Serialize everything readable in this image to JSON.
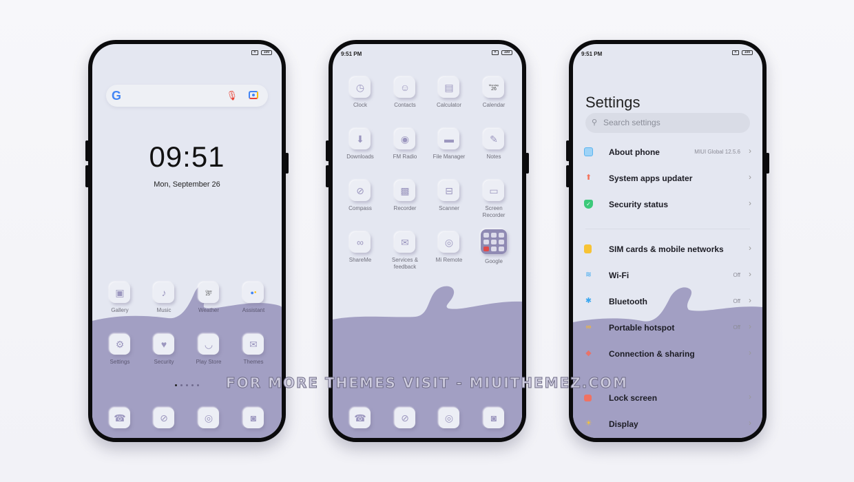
{
  "colors": {
    "screen_bg": "#e4e7f1",
    "wave": "#a29fc3",
    "icon_tint": "#9c97bf",
    "bezel": "#0b0b0d"
  },
  "status": {
    "time": "9:51 PM",
    "sim_icon": "sim-x-icon",
    "battery": "100"
  },
  "home": {
    "search": {
      "logo": "G",
      "mic_icon": "mic-icon",
      "lens_icon": "lens-icon"
    },
    "clock": "09:51",
    "date": "Mon, September 26",
    "weather_widget": {
      "condition": "Clear",
      "temp": "25°"
    },
    "row1": [
      {
        "label": "Gallery",
        "icon": "▣"
      },
      {
        "label": "Music",
        "icon": "♪"
      },
      {
        "label": "Weather",
        "icon": ""
      },
      {
        "label": "Assistant",
        "icon": "●"
      }
    ],
    "row2": [
      {
        "label": "Settings",
        "icon": "⚙"
      },
      {
        "label": "Security",
        "icon": "♥"
      },
      {
        "label": "Play Store",
        "icon": "◡"
      },
      {
        "label": "Themes",
        "icon": "✉"
      }
    ],
    "pages": {
      "count": 5,
      "current": 1
    },
    "dock": [
      {
        "name": "phone",
        "icon": "☎"
      },
      {
        "name": "messages",
        "icon": "⊘"
      },
      {
        "name": "chrome",
        "icon": "◎"
      },
      {
        "name": "camera",
        "icon": "◙"
      }
    ]
  },
  "drawer": {
    "rows": [
      [
        {
          "label": "Clock",
          "icon": "◷"
        },
        {
          "label": "Contacts",
          "icon": "☺"
        },
        {
          "label": "Calculator",
          "icon": "▤"
        },
        {
          "label": "Calendar",
          "icon": "",
          "day": "Monday",
          "num": "26"
        }
      ],
      [
        {
          "label": "Downloads",
          "icon": "⬇"
        },
        {
          "label": "FM Radio",
          "icon": "◉"
        },
        {
          "label": "File Manager",
          "icon": "▬"
        },
        {
          "label": "Notes",
          "icon": "✎"
        }
      ],
      [
        {
          "label": "Compass",
          "icon": "⊘"
        },
        {
          "label": "Recorder",
          "icon": "▩"
        },
        {
          "label": "Scanner",
          "icon": "⊟"
        },
        {
          "label": "Screen Recorder",
          "icon": "▭"
        }
      ],
      [
        {
          "label": "ShareMe",
          "icon": "∞"
        },
        {
          "label": "Services & feedback",
          "icon": "✉"
        },
        {
          "label": "Mi Remote",
          "icon": "◎"
        },
        {
          "label": "Google",
          "icon": "▦"
        }
      ]
    ],
    "dock": [
      {
        "name": "phone",
        "icon": "☎"
      },
      {
        "name": "messages",
        "icon": "⊘"
      },
      {
        "name": "chrome",
        "icon": "◎"
      },
      {
        "name": "camera",
        "icon": "◙"
      }
    ]
  },
  "settings": {
    "title": "Settings",
    "search_placeholder": "Search settings",
    "group1": [
      {
        "label": "About phone",
        "value": "MIUI Global 12.5.6",
        "icon": "phone-icon",
        "color": "#5ab4f0",
        "glyph": ""
      },
      {
        "label": "System apps updater",
        "value": "",
        "icon": "arrow-up-icon",
        "color": "#f4735c",
        "glyph": "⬆"
      },
      {
        "label": "Security status",
        "value": "",
        "icon": "shield-check-icon",
        "color": "#3cc97a",
        "glyph": "✓"
      }
    ],
    "group2": [
      {
        "label": "SIM cards & mobile networks",
        "value": "",
        "icon": "sim-icon",
        "color": "#f7c335",
        "glyph": ""
      },
      {
        "label": "Wi-Fi",
        "value": "Off",
        "icon": "wifi-icon",
        "color": "#3aa7f0",
        "glyph": "≋"
      },
      {
        "label": "Bluetooth",
        "value": "Off",
        "icon": "bluetooth-icon",
        "color": "#3aa7f0",
        "glyph": "✱"
      },
      {
        "label": "Portable hotspot",
        "value": "Off",
        "icon": "hotspot-icon",
        "color": "#f2b53a",
        "glyph": "∞"
      },
      {
        "label": "Connection & sharing",
        "value": "",
        "icon": "connection-icon",
        "color": "#e8736a",
        "glyph": "◆"
      }
    ],
    "group3": [
      {
        "label": "Lock screen",
        "value": "",
        "icon": "lock-icon",
        "color": "#f07262",
        "glyph": ""
      },
      {
        "label": "Display",
        "value": "",
        "icon": "sun-icon",
        "color": "#f5c335",
        "glyph": "☀"
      }
    ]
  },
  "watermark": "FOR MORE THEMES VISIT - MIUITHEMEZ.COM"
}
